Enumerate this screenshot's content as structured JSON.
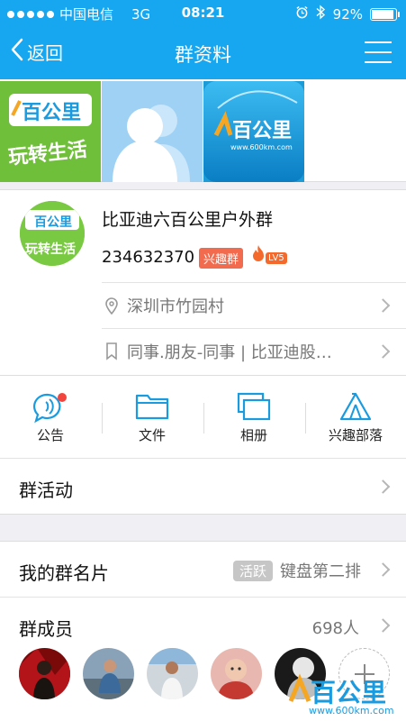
{
  "status_bar": {
    "carrier": "中国电信",
    "network": "3G",
    "time": "08:21",
    "battery": "92%",
    "battery_level": 0.92
  },
  "nav": {
    "back_label": "返回",
    "title": "群资料"
  },
  "group": {
    "name": "比亚迪六百公里户外群",
    "id": "234632370",
    "tag": "兴趣群",
    "level": "LV5",
    "location": "深圳市竹园村",
    "category": "同事.朋友-同事 | 比亚迪股…"
  },
  "actions": [
    {
      "label": "公告",
      "icon": "announcement-icon"
    },
    {
      "label": "文件",
      "icon": "folder-icon"
    },
    {
      "label": "相册",
      "icon": "album-icon"
    },
    {
      "label": "兴趣部落",
      "icon": "tribe-icon"
    }
  ],
  "activity": {
    "label": "群活动"
  },
  "my_card": {
    "label": "我的群名片",
    "badge": "活跃",
    "value": "键盘第二排"
  },
  "members": {
    "label": "群成员",
    "count": "698人"
  },
  "watermark": {
    "brand": "百公里",
    "url": "www.600km.com"
  },
  "photo_logo": {
    "brand": "百公里",
    "slogan": "玩转生活"
  },
  "colors": {
    "nav": "#16a7f0",
    "accent": "#1a9be0",
    "tag": "#f26b4f",
    "badge_dot": "#f2453d"
  }
}
